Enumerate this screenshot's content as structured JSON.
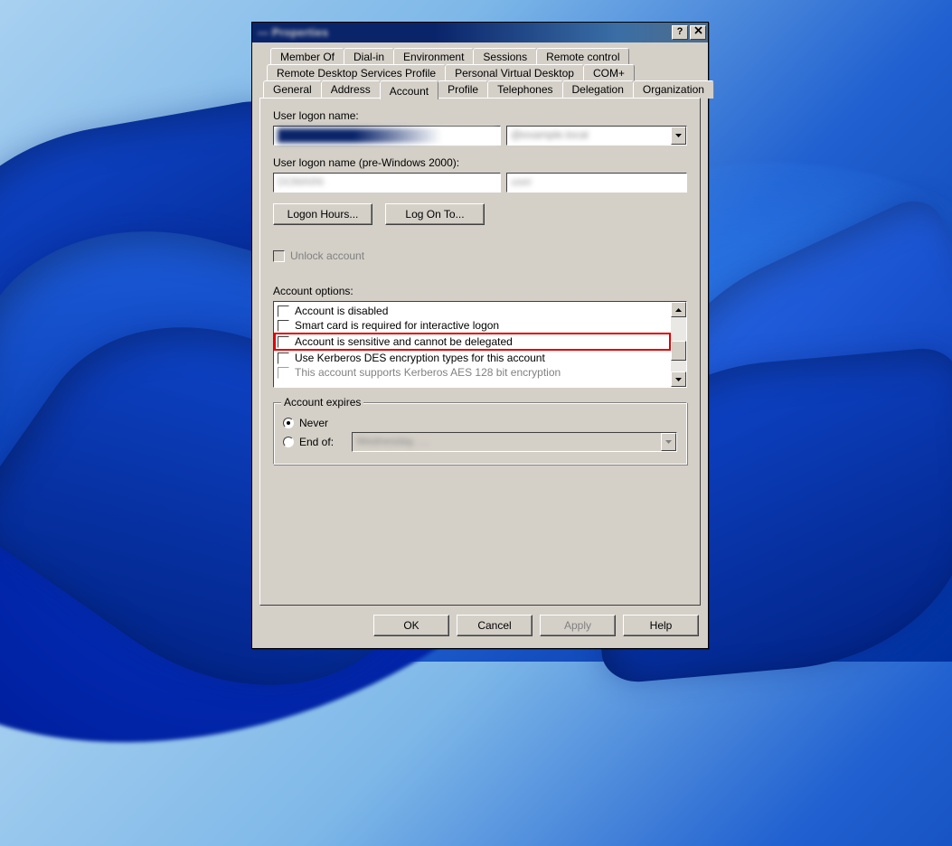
{
  "window": {
    "title": "— Properties"
  },
  "tabs": {
    "row1": [
      "Member Of",
      "Dial-in",
      "Environment",
      "Sessions",
      "Remote control"
    ],
    "row2": [
      "Remote Desktop Services Profile",
      "Personal Virtual Desktop",
      "COM+"
    ],
    "row3": [
      "General",
      "Address",
      "Account",
      "Profile",
      "Telephones",
      "Delegation",
      "Organization"
    ],
    "active": "Account"
  },
  "account": {
    "logon_label": "User logon name:",
    "logon_value": "",
    "domain_value": "",
    "pre2000_label": "User logon name (pre-Windows 2000):",
    "pre2000_domain": "",
    "pre2000_user": "",
    "btn_logon_hours": "Logon Hours...",
    "btn_log_on_to": "Log On To...",
    "unlock_label": "Unlock account",
    "options_label": "Account options:",
    "options": [
      "Account is disabled",
      "Smart card is required for interactive logon",
      "Account is sensitive and cannot be delegated",
      "Use Kerberos DES encryption types for this account",
      "This account supports Kerberos AES 128 bit encryption"
    ],
    "highlight_index": 2,
    "group_caption": "Account expires",
    "radio_never": "Never",
    "radio_end_of": "End of:",
    "end_of_value": ""
  },
  "buttons": {
    "ok": "OK",
    "cancel": "Cancel",
    "apply": "Apply",
    "help": "Help"
  }
}
